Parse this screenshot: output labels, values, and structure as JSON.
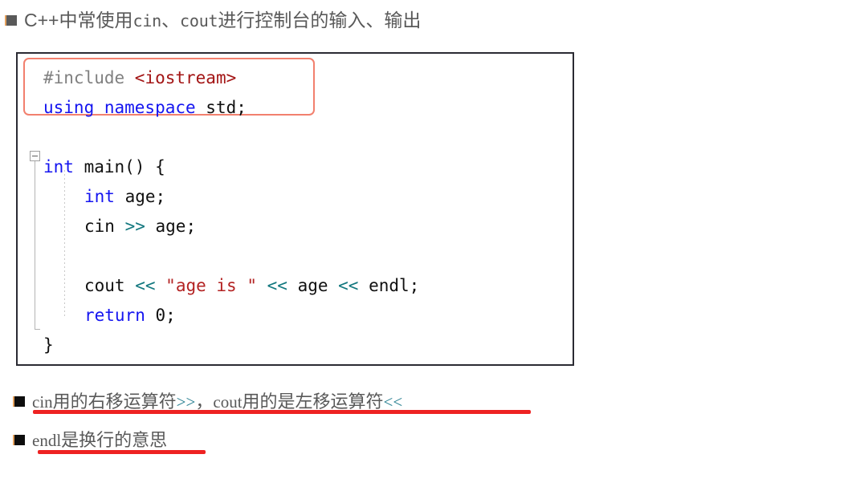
{
  "slide": {
    "background": "#ffffff",
    "accent_red": "#ee2222",
    "highlight_border": "#f2806e",
    "code_border": "#2b2b33"
  },
  "bullets": {
    "top": {
      "marker": "square-bullet-gray",
      "segments": [
        {
          "kind": "cjk",
          "text": "C++中常使用"
        },
        {
          "kind": "mono",
          "text": "cin"
        },
        {
          "kind": "cjk",
          "text": "、"
        },
        {
          "kind": "mono",
          "text": "cout"
        },
        {
          "kind": "cjk",
          "text": "进行控制台的输入、输出"
        }
      ],
      "plain": "C++中常使用cin、cout进行控制台的输入、输出"
    },
    "second": {
      "marker": "square-bullet-black",
      "segments": [
        {
          "kind": "mono",
          "text": "cin"
        },
        {
          "kind": "cjk",
          "text": "用的右移运算符"
        },
        {
          "kind": "op",
          "text": ">>"
        },
        {
          "kind": "cjk",
          "text": "，"
        },
        {
          "kind": "mono",
          "text": "cout"
        },
        {
          "kind": "cjk",
          "text": "用的是左移运算符"
        },
        {
          "kind": "op",
          "text": "<<"
        }
      ],
      "plain": "cin用的右移运算符>>，cout用的是左移运算符<<",
      "underlined": true
    },
    "third": {
      "marker": "square-bullet-black",
      "segments": [
        {
          "kind": "mono",
          "text": "endl"
        },
        {
          "kind": "cjk",
          "text": "是换行的意思"
        }
      ],
      "plain": "endl是换行的意思",
      "underlined": true
    }
  },
  "code_block": {
    "language": "cpp",
    "fold_widget": "collapse-minus",
    "highlight_lines": [
      1,
      2
    ],
    "lines": [
      {
        "n": 1,
        "indent": 0,
        "text": "#include <iostream>",
        "tokens": [
          {
            "t": "#include ",
            "c": "pre"
          },
          {
            "t": "<iostream>",
            "c": "hdr"
          }
        ]
      },
      {
        "n": 2,
        "indent": 0,
        "text": "using namespace std;",
        "tokens": [
          {
            "t": "using namespace ",
            "c": "kw"
          },
          {
            "t": "std;",
            "c": "plain"
          }
        ]
      },
      {
        "n": 3,
        "indent": 0,
        "text": "",
        "tokens": []
      },
      {
        "n": 4,
        "indent": 0,
        "text": "int main() {",
        "tokens": [
          {
            "t": "int",
            "c": "type"
          },
          {
            "t": " main() {",
            "c": "plain"
          }
        ]
      },
      {
        "n": 5,
        "indent": 1,
        "text": "int age;",
        "tokens": [
          {
            "t": "int",
            "c": "type"
          },
          {
            "t": " age;",
            "c": "plain"
          }
        ]
      },
      {
        "n": 6,
        "indent": 1,
        "text": "cin >> age;",
        "tokens": [
          {
            "t": "cin ",
            "c": "plain"
          },
          {
            "t": ">>",
            "c": "op"
          },
          {
            "t": " age;",
            "c": "plain"
          }
        ]
      },
      {
        "n": 7,
        "indent": 0,
        "text": "",
        "tokens": []
      },
      {
        "n": 8,
        "indent": 1,
        "text": "cout << \"age is \" << age << endl;",
        "tokens": [
          {
            "t": "cout ",
            "c": "plain"
          },
          {
            "t": "<<",
            "c": "op"
          },
          {
            "t": " ",
            "c": "plain"
          },
          {
            "t": "\"age is \"",
            "c": "str"
          },
          {
            "t": " ",
            "c": "plain"
          },
          {
            "t": "<<",
            "c": "op"
          },
          {
            "t": " age ",
            "c": "plain"
          },
          {
            "t": "<<",
            "c": "op"
          },
          {
            "t": " endl;",
            "c": "plain"
          }
        ]
      },
      {
        "n": 9,
        "indent": 1,
        "text": "return 0;",
        "tokens": [
          {
            "t": "return",
            "c": "kw"
          },
          {
            "t": " ",
            "c": "plain"
          },
          {
            "t": "0;",
            "c": "num"
          }
        ]
      },
      {
        "n": 10,
        "indent": 0,
        "text": "}",
        "tokens": [
          {
            "t": "}",
            "c": "plain"
          }
        ]
      }
    ]
  }
}
